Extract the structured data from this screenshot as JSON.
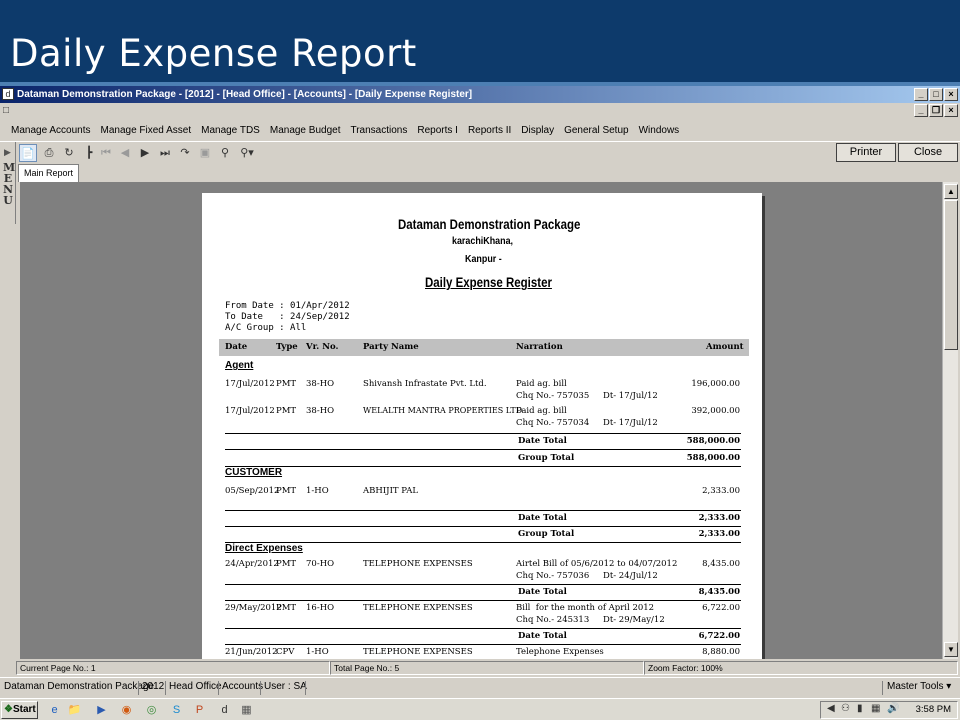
{
  "slide_title": "Daily Expense Report",
  "window": {
    "title": "Dataman Demonstration Package - [2012] - [Head Office] - [Accounts] - [Daily Expense Register]",
    "min": "_",
    "max": "□",
    "close": "×",
    "mdi_min": "_",
    "mdi_restore": "á",
    "mdi_close": "×"
  },
  "menu": [
    "Manage Accounts",
    "Manage Fixed Asset",
    "Manage TDS",
    "Manage Budget",
    "Transactions",
    "Reports I",
    "Reports II",
    "Display",
    "General Setup",
    "Windows"
  ],
  "side_menu_label": "MENU",
  "buttons": {
    "printer": "Printer",
    "close": "Close"
  },
  "tab": "Main Report",
  "report": {
    "company": "Dataman Demonstration Package",
    "address1": "karachiKhana,",
    "address2": "Kanpur -",
    "title": "Daily Expense Register",
    "params": [
      "From Date : 01/Apr/2012",
      "To Date   : 24/Sep/2012",
      "A/C Group : All"
    ],
    "columns": [
      "Date",
      "Type",
      "Vr. No.",
      "Party Name",
      "Narration",
      "Amount"
    ],
    "groups": [
      {
        "name": "Agent",
        "rows": [
          {
            "date": "17/Jul/2012",
            "type": "PMT",
            "vr": "38-HO",
            "party": "Shivansh Infrastate Pvt. Ltd.",
            "narr": "Paid ag. bill",
            "chq": "Chq No.-  757035",
            "dt": "Dt-  17/Jul/12",
            "amount": "196,000.00"
          },
          {
            "date": "17/Jul/2012",
            "type": "PMT",
            "vr": "38-HO",
            "party": "WELALTH MANTRA PROPERTIES LTD",
            "narr": "Paid ag. bill",
            "chq": "Chq No.-  757034",
            "dt": "Dt-  17/Jul/12",
            "amount": "392,000.00"
          }
        ],
        "date_total": "588,000.00",
        "group_total": "588,000.00"
      },
      {
        "name": "CUSTOMER",
        "rows": [
          {
            "date": "05/Sep/2012",
            "type": "PMT",
            "vr": "1-HO",
            "party": "ABHIJIT PAL",
            "narr": "",
            "chq": "",
            "dt": "",
            "amount": "2,333.00"
          }
        ],
        "date_total": "2,333.00",
        "group_total": "2,333.00"
      },
      {
        "name": "Direct Expenses",
        "rows": [
          {
            "date": "24/Apr/2012",
            "type": "PMT",
            "vr": "70-HO",
            "party": "TELEPHONE EXPENSES",
            "narr": "Airtel Bill of 05/6/2012 to 04/07/2012",
            "chq": "Chq No.-  757036",
            "dt": "Dt-  24/Jul/12",
            "amount": "8,435.00"
          },
          {
            "date": "29/May/2012",
            "type": "PMT",
            "vr": "16-HO",
            "party": "TELEPHONE EXPENSES",
            "narr": "Bill  for the month of April 2012",
            "chq": "Chq No.-  245313",
            "dt": "Dt-  29/May/12",
            "amount": "6,722.00"
          },
          {
            "date": "21/Jun/2012",
            "type": "CPV",
            "vr": "1-HO",
            "party": "TELEPHONE EXPENSES",
            "narr": "Telephone Expenses",
            "chq": "",
            "dt": "",
            "amount": "8,880.00"
          }
        ],
        "date_totals": [
          "8,435.00",
          "6,722.00"
        ]
      }
    ],
    "date_total_label": "Date Total",
    "group_total_label": "Group Total"
  },
  "status": {
    "current_page": "Current Page No.: 1",
    "total_page": "Total Page No.: 5",
    "zoom": "Zoom Factor: 100%"
  },
  "appbar": {
    "package": "Dataman Demonstration Package",
    "year": "2012",
    "office": "Head Office",
    "module": "Accounts",
    "user": "User : SA",
    "tools": "Master Tools"
  },
  "taskbar": {
    "start": "Start",
    "clock": "3:58 PM"
  }
}
